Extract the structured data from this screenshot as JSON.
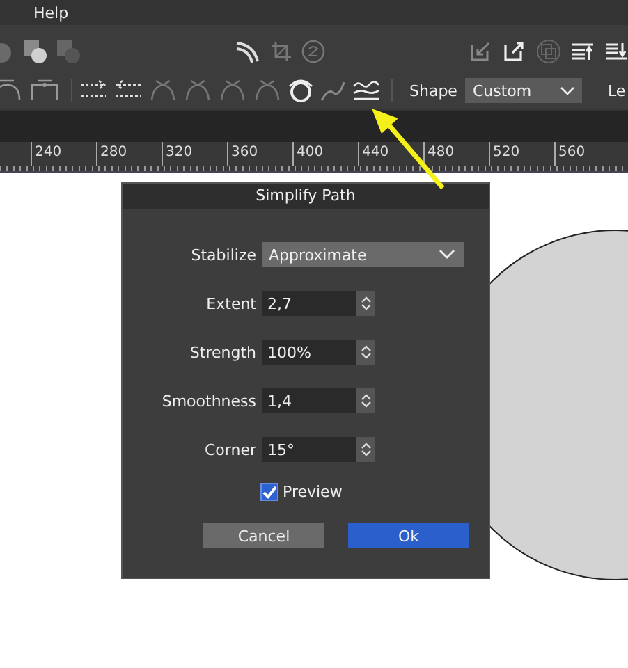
{
  "menu": [
    "Help"
  ],
  "toolbar": {
    "shape_label": "Shape",
    "shape_value": "Custom",
    "cut_label": "Le"
  },
  "ruler": [
    "240",
    "280",
    "320",
    "360",
    "400",
    "440",
    "480",
    "520",
    "560"
  ],
  "dialog": {
    "title": "Simplify Path",
    "stabilize": {
      "label": "Stabilize",
      "value": "Approximate"
    },
    "fields": [
      {
        "label": "Extent",
        "value": "2,7"
      },
      {
        "label": "Strength",
        "value": "100%"
      },
      {
        "label": "Smoothness",
        "value": "1,4"
      },
      {
        "label": "Corner",
        "value": "15°"
      }
    ],
    "preview": {
      "label": "Preview",
      "checked": true
    },
    "buttons": [
      {
        "label": "Cancel",
        "kind": "secondary"
      },
      {
        "label": "Ok",
        "kind": "primary"
      }
    ]
  }
}
